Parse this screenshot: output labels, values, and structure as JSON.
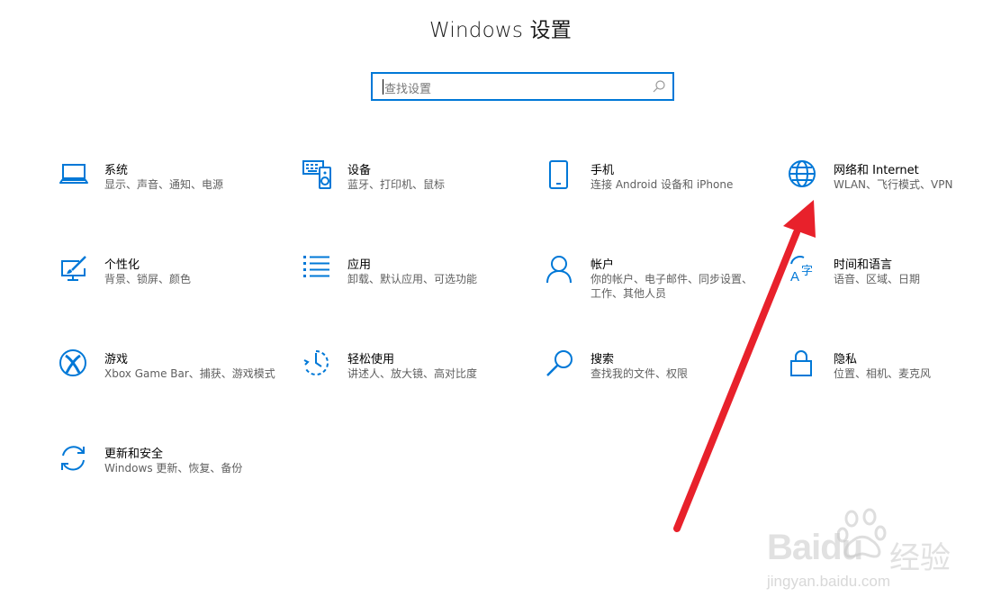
{
  "window": {
    "title": "Windows 设置"
  },
  "search": {
    "placeholder": "查找设置",
    "icon": "search-icon"
  },
  "accent_color": "#0078d7",
  "arrow_color": "#e8212b",
  "tiles": [
    {
      "name": "系统",
      "desc": "显示、声音、通知、电源",
      "icon": "laptop-icon"
    },
    {
      "name": "设备",
      "desc": "蓝牙、打印机、鼠标",
      "icon": "keyboard-speaker-icon"
    },
    {
      "name": "手机",
      "desc": "连接 Android 设备和 iPhone",
      "icon": "phone-icon"
    },
    {
      "name": "网络和 Internet",
      "desc": "WLAN、飞行模式、VPN",
      "icon": "globe-icon"
    },
    {
      "name": "个性化",
      "desc": "背景、锁屏、颜色",
      "icon": "paint-icon"
    },
    {
      "name": "应用",
      "desc": "卸载、默认应用、可选功能",
      "icon": "apps-list-icon"
    },
    {
      "name": "帐户",
      "desc": "你的帐户、电子邮件、同步设置、工作、其他人员",
      "icon": "person-icon"
    },
    {
      "name": "时间和语言",
      "desc": "语音、区域、日期",
      "icon": "time-language-icon"
    },
    {
      "name": "游戏",
      "desc": "Xbox Game Bar、捕获、游戏模式",
      "icon": "xbox-icon"
    },
    {
      "name": "轻松使用",
      "desc": "讲述人、放大镜、高对比度",
      "icon": "ease-of-access-icon"
    },
    {
      "name": "搜索",
      "desc": "查找我的文件、权限",
      "icon": "magnifier-icon"
    },
    {
      "name": "隐私",
      "desc": "位置、相机、麦克风",
      "icon": "lock-icon"
    },
    {
      "name": "更新和安全",
      "desc": "Windows 更新、恢复、备份",
      "icon": "sync-icon"
    }
  ],
  "watermark": {
    "brand": "Baidu",
    "cn": "经验",
    "url": "jingyan.baidu.com"
  }
}
